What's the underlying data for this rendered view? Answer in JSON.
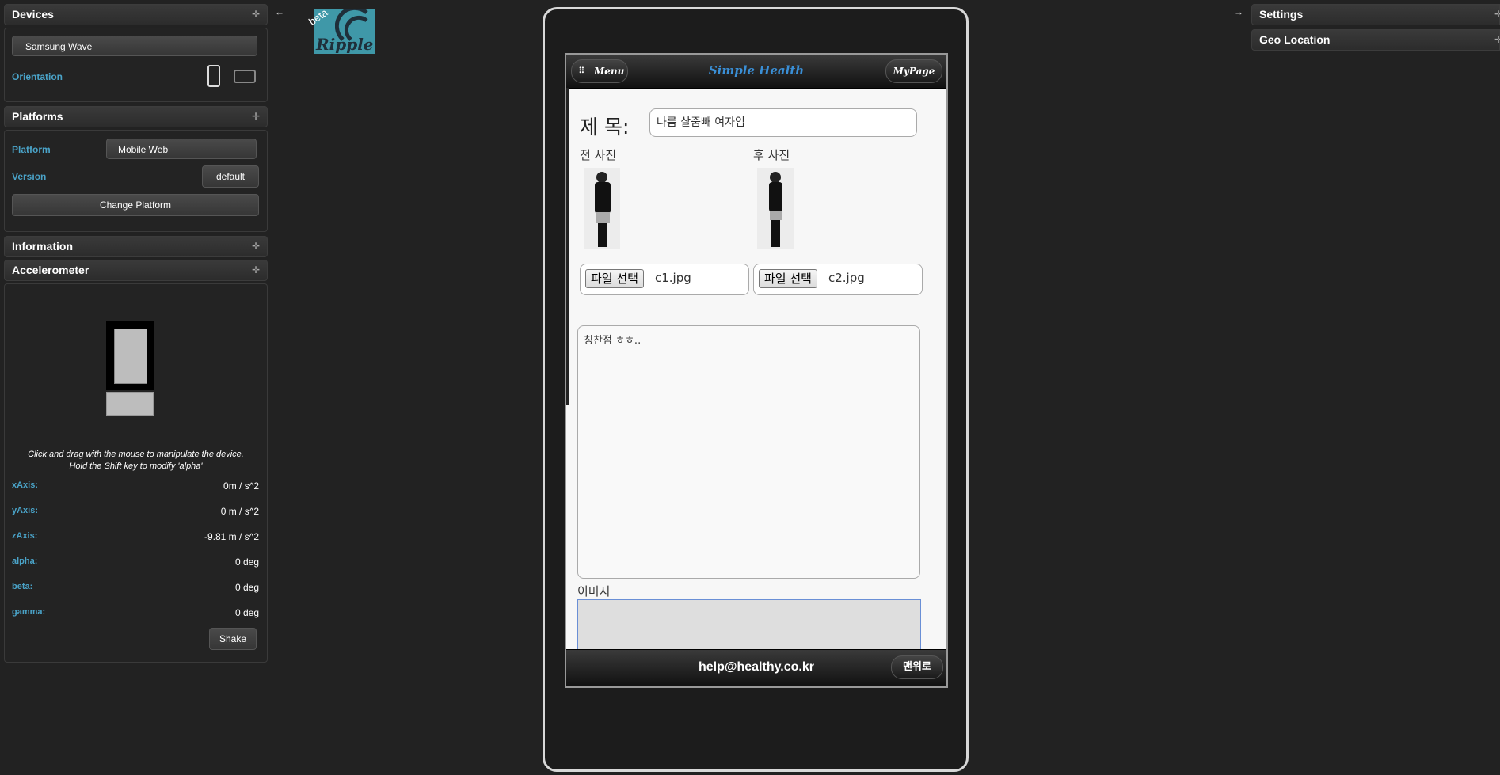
{
  "left_panel": {
    "devices": {
      "title": "Devices",
      "device_name": "Samsung Wave",
      "orientation_label": "Orientation"
    },
    "platforms": {
      "title": "Platforms",
      "platform_label": "Platform",
      "platform_value": "Mobile Web",
      "version_label": "Version",
      "version_value": "default",
      "change_button": "Change Platform"
    },
    "information": {
      "title": "Information"
    },
    "accelerometer": {
      "title": "Accelerometer",
      "instructions_1": "Click and drag with the mouse to manipulate the device.",
      "instructions_2": "Hold the Shift key to modify 'alpha'",
      "rows": [
        {
          "label": "xAxis:",
          "value": "0m / s^2"
        },
        {
          "label": "yAxis:",
          "value": "0 m / s^2"
        },
        {
          "label": "zAxis:",
          "value": "-9.81 m / s^2"
        },
        {
          "label": "alpha:",
          "value": "0 deg"
        },
        {
          "label": "beta:",
          "value": "0 deg"
        },
        {
          "label": "gamma:",
          "value": "0 deg"
        }
      ],
      "shake_button": "Shake"
    }
  },
  "logo": {
    "text": "Ripple",
    "badge": "beta"
  },
  "right_panel": {
    "settings_title": "Settings",
    "geo_title": "Geo Location"
  },
  "app": {
    "header": {
      "menu_label": "Menu",
      "title": "Simple Health",
      "mypage_label": "MyPage"
    },
    "form": {
      "title_label": "제 목:",
      "title_value": "나름 살줌빼 여자임",
      "before_label": "전 사진",
      "after_label": "후 사진",
      "file_button": "파일 선택",
      "file1": "c1.jpg",
      "file2": "c2.jpg",
      "textarea_value": "칭찬점 ㅎㅎ..",
      "image_label": "이미지"
    },
    "footer": {
      "email": "help@healthy.co.kr",
      "top_button": "맨위로"
    }
  },
  "colors": {
    "accent": "#4aa3c8",
    "background": "#222222",
    "app_title": "#3a8fd6"
  }
}
